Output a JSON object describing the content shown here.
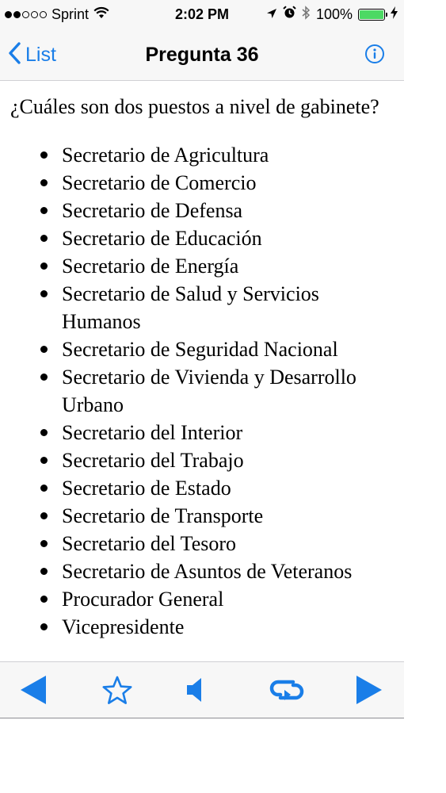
{
  "status_bar": {
    "carrier": "Sprint",
    "time": "2:02 PM",
    "battery_percent": "100%",
    "battery_level": 1.0,
    "battery_color": "#4cd964",
    "signal_bars_filled": 2,
    "signal_bars_total": 5,
    "icons": [
      "wifi-icon",
      "location-arrow-icon",
      "alarm-icon",
      "bluetooth-icon",
      "battery-icon",
      "charging-bolt-icon"
    ]
  },
  "nav": {
    "back_label": "List",
    "title": "Pregunta 36",
    "info_icon": "info-icon"
  },
  "content": {
    "question": "¿Cuáles son dos puestos a nivel de gabinete?",
    "answers": [
      "Secretario de Agricultura",
      "Secretario de Comercio",
      "Secretario de Defensa",
      "Secretario de Educación",
      "Secretario de Energía",
      "Secretario de Salud y Servicios Humanos",
      "Secretario de Seguridad Nacional",
      "Secretario de Vivienda y Desarrollo Urbano",
      "Secretario del Interior",
      "Secretario del Trabajo",
      "Secretario de Estado",
      "Secretario de Transporte",
      "Secretario del Tesoro",
      "Secretario de Asuntos de Veteranos",
      "Procurador General",
      "Vicepresidente"
    ]
  },
  "toolbar": {
    "buttons": [
      "previous-icon",
      "star-icon",
      "speaker-icon",
      "repeat-icon",
      "next-icon"
    ]
  },
  "colors": {
    "accent": "#1a7ee8",
    "bar_background": "#f7f7f7",
    "separator": "#d0d0d4"
  }
}
